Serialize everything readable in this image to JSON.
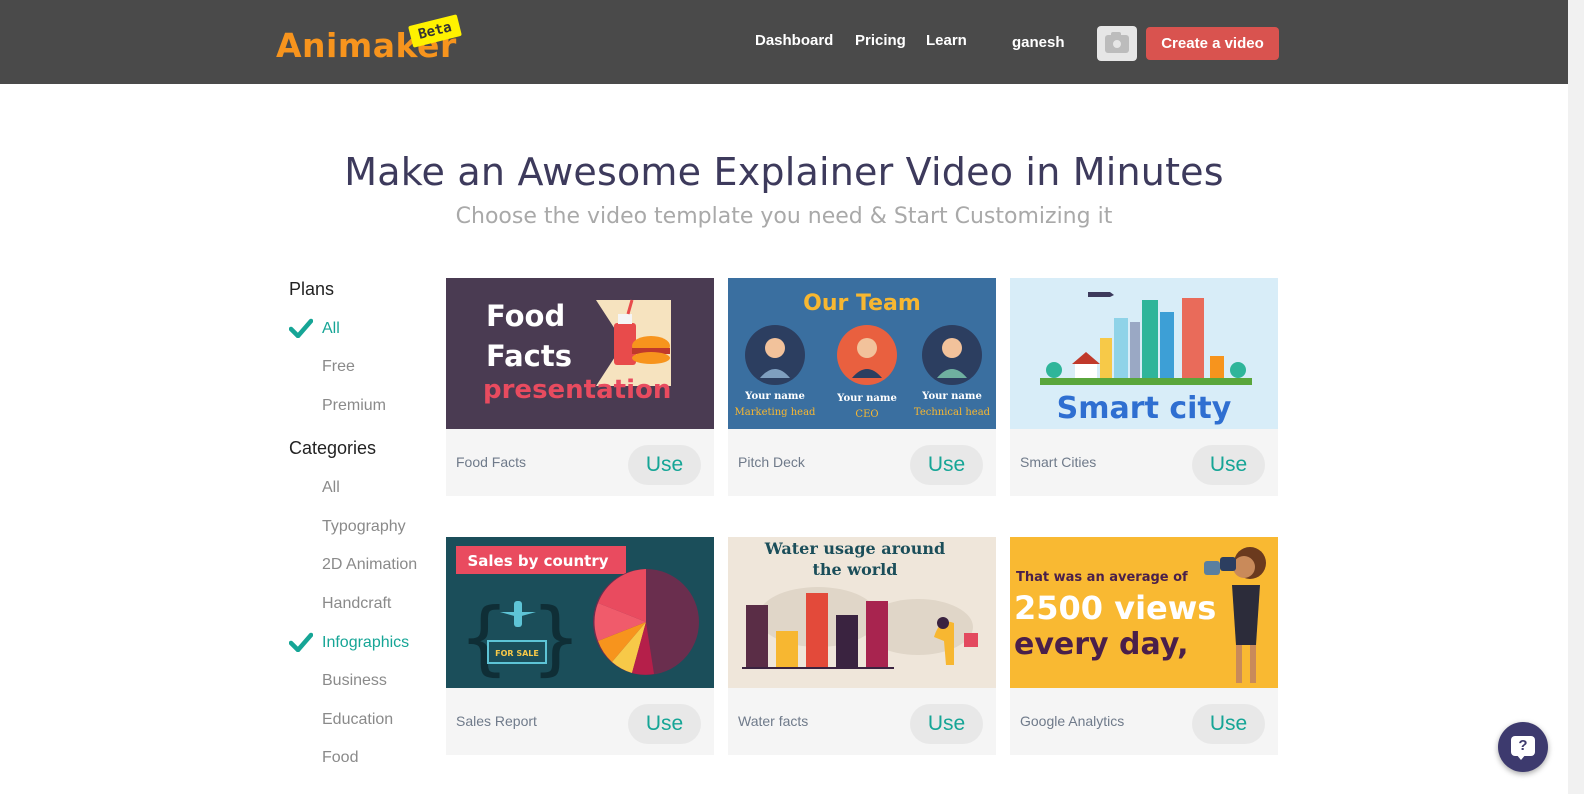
{
  "header": {
    "logo": "Animaker",
    "beta": "Beta",
    "nav": [
      "Dashboard",
      "Pricing",
      "Learn"
    ],
    "user": "ganesh",
    "create_label": "Create a video"
  },
  "hero": {
    "title": "Make an Awesome Explainer Video in Minutes",
    "subtitle": "Choose the video template you need & Start Customizing it"
  },
  "sidebar": {
    "plans_title": "Plans",
    "plans": [
      "All",
      "Free",
      "Premium"
    ],
    "categories_title": "Categories",
    "categories": [
      "All",
      "Typography",
      "2D Animation",
      "Handcraft",
      "Infographics",
      "Business",
      "Education",
      "Food"
    ]
  },
  "cards": [
    {
      "label": "Food Facts",
      "use": "Use",
      "thumb": {
        "line1": "Food",
        "line2": "Facts",
        "line3": "presentation"
      }
    },
    {
      "label": "Pitch Deck",
      "use": "Use",
      "thumb": {
        "title": "Our Team",
        "names": [
          "Your name",
          "Your name",
          "Your name"
        ],
        "roles": [
          "Marketing head",
          "CEO",
          "Technical head"
        ]
      }
    },
    {
      "label": "Smart Cities",
      "use": "Use",
      "thumb": {
        "title": "Smart city"
      }
    },
    {
      "label": "Sales Report",
      "use": "Use",
      "thumb": {
        "title": "Sales by country",
        "sign": "FOR SALE"
      }
    },
    {
      "label": "Water facts",
      "use": "Use",
      "thumb": {
        "title1": "Water usage around",
        "title2": "the world"
      }
    },
    {
      "label": "Google Analytics",
      "use": "Use",
      "thumb": {
        "line1": "That was an average of",
        "line2": "2500 views",
        "line3": "every day,"
      }
    }
  ],
  "help_glyph": "?",
  "icons": [
    "check-icon",
    "camera-icon",
    "help-chat-icon"
  ]
}
